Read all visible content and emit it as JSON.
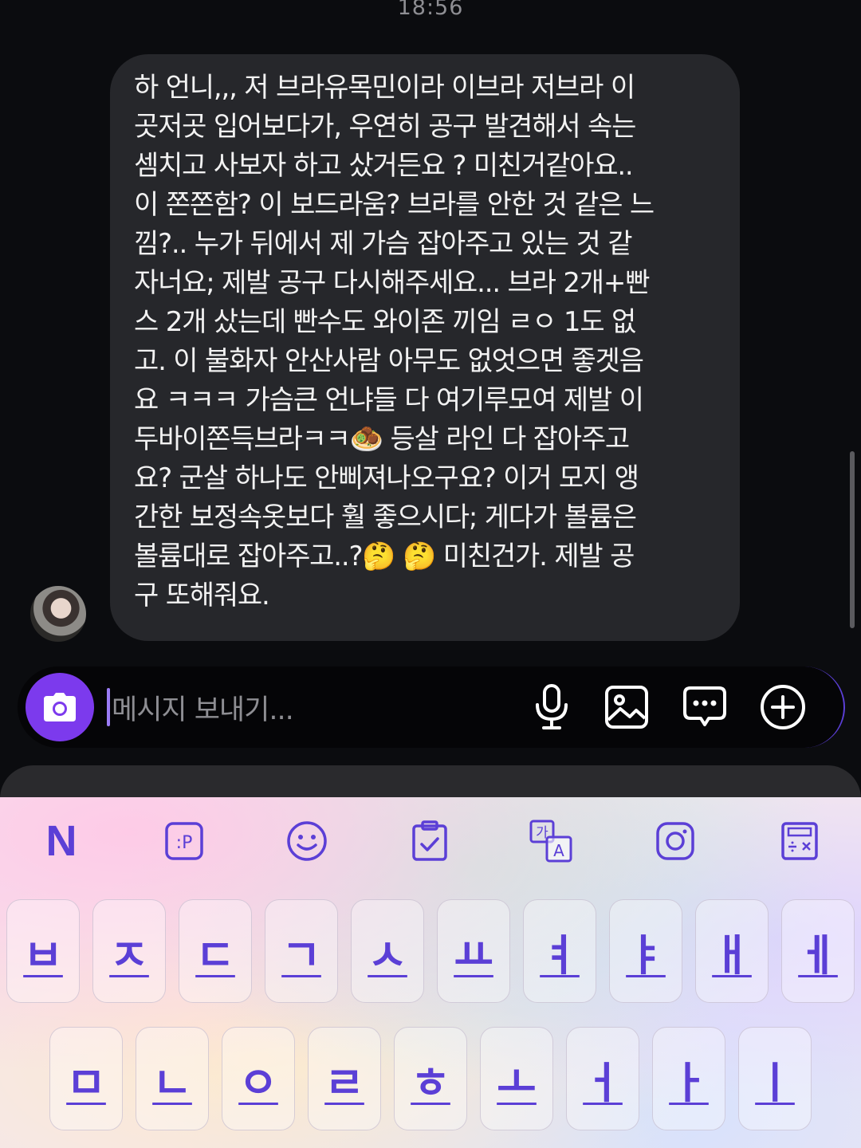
{
  "status": {
    "time": "18:56"
  },
  "message": {
    "text": "하 언니,,, 저 브라유목민이라 이브라 저브라 이\n곳저곳 입어보다가, 우연히 공구 발견해서 속는\n셈치고 사보자 하고 샀거든요 ? 미친거같아요..\n이 쫀쫀함? 이 보드라움? 브라를 안한 것 같은 느\n낌?.. 누가 뒤에서 제 가슴 잡아주고 있는 것 같\n자너요; 제발 공구 다시해주세요... 브라 2개+빤\n스 2개 샀는데 빤수도 와이존 끼임 ㄹㅇ 1도 없\n고. 이 불화자 안산사람 아무도 없엇으면 좋겟음\n요 ㅋㅋㅋ 가슴큰 언냐들 다 여기루모여 제발 이\n두바이쫀득브라ㅋㅋ🧆 등살 라인 다 잡아주고\n요? 군살 하나도 안삐져나오구요? 이거 모지 앵\n간한 보정속옷보다 훨 좋으시다; 게다가 볼륨은\n볼륨대로 잡아주고..?🤔 🤔 미친건가. 제발 공\n구 또해줘요."
  },
  "composer": {
    "placeholder": "메시지 보내기...",
    "icons": [
      "camera-icon",
      "microphone-icon",
      "image-icon",
      "chat-bubble-icon",
      "plus-circle-icon"
    ],
    "accent": "#7c3aed"
  },
  "keyboard": {
    "toolbar": {
      "n_label": "N",
      "translate_top": "가",
      "translate_bottom": "A",
      "sticker_label": ":P"
    },
    "row1": [
      "ㅂ",
      "ㅈ",
      "ㄷ",
      "ㄱ",
      "ㅅ",
      "ㅛ",
      "ㅕ",
      "ㅑ",
      "ㅐ",
      "ㅔ"
    ],
    "row2": [
      "ㅁ",
      "ㄴ",
      "ㅇ",
      "ㄹ",
      "ㅎ",
      "ㅗ",
      "ㅓ",
      "ㅏ",
      "ㅣ"
    ],
    "key_color": "#5b3fd6"
  }
}
